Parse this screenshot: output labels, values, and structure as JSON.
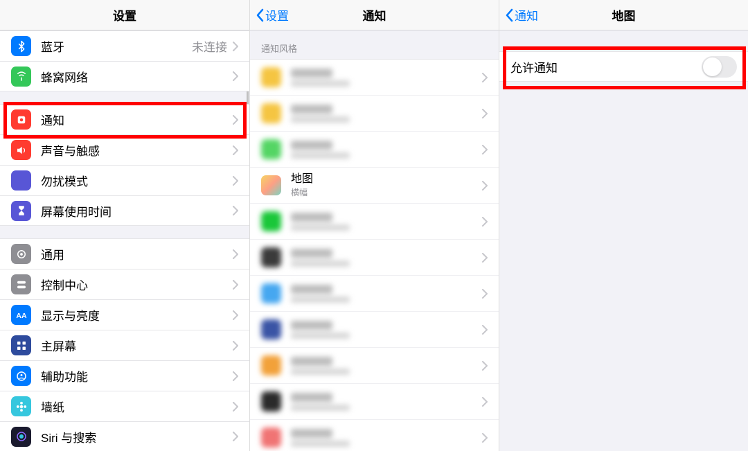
{
  "panel1": {
    "title": "设置",
    "groups": [
      [
        {
          "id": "bluetooth",
          "label": "蓝牙",
          "value": "未连接",
          "color": "#007aff",
          "chev": true,
          "icon": "bluetooth"
        },
        {
          "id": "cellular",
          "label": "蜂窝网络",
          "value": "",
          "color": "#34c759",
          "chev": true,
          "icon": "antenna"
        }
      ],
      [
        {
          "id": "notifications",
          "label": "通知",
          "value": "",
          "color": "#ff3b30",
          "chev": true,
          "icon": "bell"
        },
        {
          "id": "sounds",
          "label": "声音与触感",
          "value": "",
          "color": "#ff3b30",
          "chev": true,
          "icon": "speaker"
        },
        {
          "id": "dnd",
          "label": "勿扰模式",
          "value": "",
          "color": "#5856d6",
          "chev": true,
          "icon": "moon"
        },
        {
          "id": "screentime",
          "label": "屏幕使用时间",
          "value": "",
          "color": "#5856d6",
          "chev": true,
          "icon": "hourglass"
        }
      ],
      [
        {
          "id": "general",
          "label": "通用",
          "value": "",
          "color": "#8e8e93",
          "chev": true,
          "icon": "gear"
        },
        {
          "id": "controlcenter",
          "label": "控制中心",
          "value": "",
          "color": "#8e8e93",
          "chev": true,
          "icon": "switches"
        },
        {
          "id": "display",
          "label": "显示与亮度",
          "value": "",
          "color": "#007aff",
          "chev": true,
          "icon": "aa"
        },
        {
          "id": "homescreen",
          "label": "主屏幕",
          "value": "",
          "color": "#2e4b9d",
          "chev": true,
          "icon": "grid"
        },
        {
          "id": "accessibility",
          "label": "辅助功能",
          "value": "",
          "color": "#007aff",
          "chev": true,
          "icon": "person"
        },
        {
          "id": "wallpaper",
          "label": "墙纸",
          "value": "",
          "color": "#36c7de",
          "chev": true,
          "icon": "flower"
        },
        {
          "id": "siri",
          "label": "Siri 与搜索",
          "value": "",
          "color": "#1a1a2e",
          "chev": true,
          "icon": "siri"
        }
      ]
    ]
  },
  "panel2": {
    "back": "设置",
    "title": "通知",
    "section_header": "通知风格",
    "maps_row": {
      "title": "地图",
      "subtitle": "横幅"
    },
    "blurred_icon_colors": [
      "#f5c542",
      "#f5c542",
      "#54d564",
      "#1ac739",
      "#3a3a3a",
      "#46a7f0",
      "#3a54a5",
      "#f2a13a",
      "#2a2a2a",
      "#f07474"
    ]
  },
  "panel3": {
    "back": "通知",
    "title": "地图",
    "allow_label": "允许通知",
    "allow_on": false
  }
}
